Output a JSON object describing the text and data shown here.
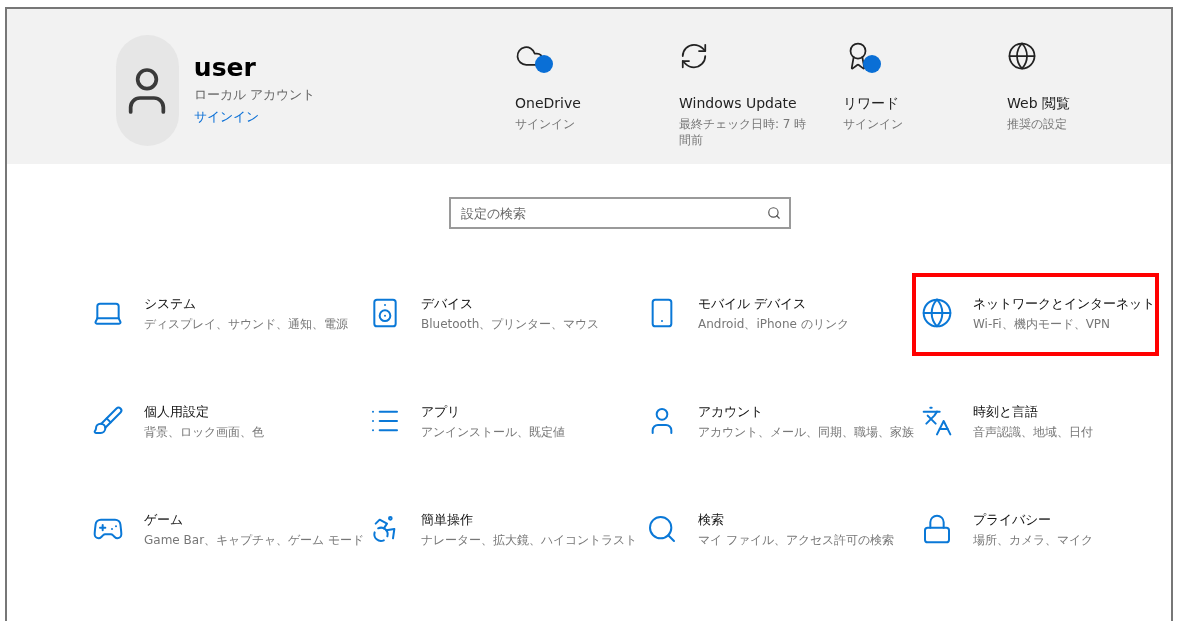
{
  "account": {
    "name": "user",
    "type": "ローカル アカウント",
    "link": "サインイン"
  },
  "quick_links": [
    {
      "title": "OneDrive",
      "subtitle": "サインイン",
      "badge": true
    },
    {
      "title": "Windows Update",
      "subtitle": "最終チェック日時: 7 時間前",
      "badge": false
    },
    {
      "title": "リワード",
      "subtitle": "サインイン",
      "badge": true
    },
    {
      "title": "Web 閲覧",
      "subtitle": "推奨の設定",
      "badge": false
    }
  ],
  "search": {
    "placeholder": "設定の検索"
  },
  "categories": [
    {
      "title": "システム",
      "subtitle": "ディスプレイ、サウンド、通知、電源",
      "highlighted": false
    },
    {
      "title": "デバイス",
      "subtitle": "Bluetooth、プリンター、マウス",
      "highlighted": false
    },
    {
      "title": "モバイル デバイス",
      "subtitle": "Android、iPhone のリンク",
      "highlighted": false
    },
    {
      "title": "ネットワークとインターネット",
      "subtitle": "Wi-Fi、機内モード、VPN",
      "highlighted": true
    },
    {
      "title": "個人用設定",
      "subtitle": "背景、ロック画面、色",
      "highlighted": false
    },
    {
      "title": "アプリ",
      "subtitle": "アンインストール、既定値",
      "highlighted": false
    },
    {
      "title": "アカウント",
      "subtitle": "アカウント、メール、同期、職場、家族",
      "highlighted": false
    },
    {
      "title": "時刻と言語",
      "subtitle": "音声認識、地域、日付",
      "highlighted": false
    },
    {
      "title": "ゲーム",
      "subtitle": "Game Bar、キャプチャ、ゲーム モード",
      "highlighted": false
    },
    {
      "title": "簡単操作",
      "subtitle": "ナレーター、拡大鏡、ハイコントラスト",
      "highlighted": false
    },
    {
      "title": "検索",
      "subtitle": "マイ ファイル、アクセス許可の検索",
      "highlighted": false
    },
    {
      "title": "プライバシー",
      "subtitle": "場所、カメラ、マイク",
      "highlighted": false
    }
  ]
}
